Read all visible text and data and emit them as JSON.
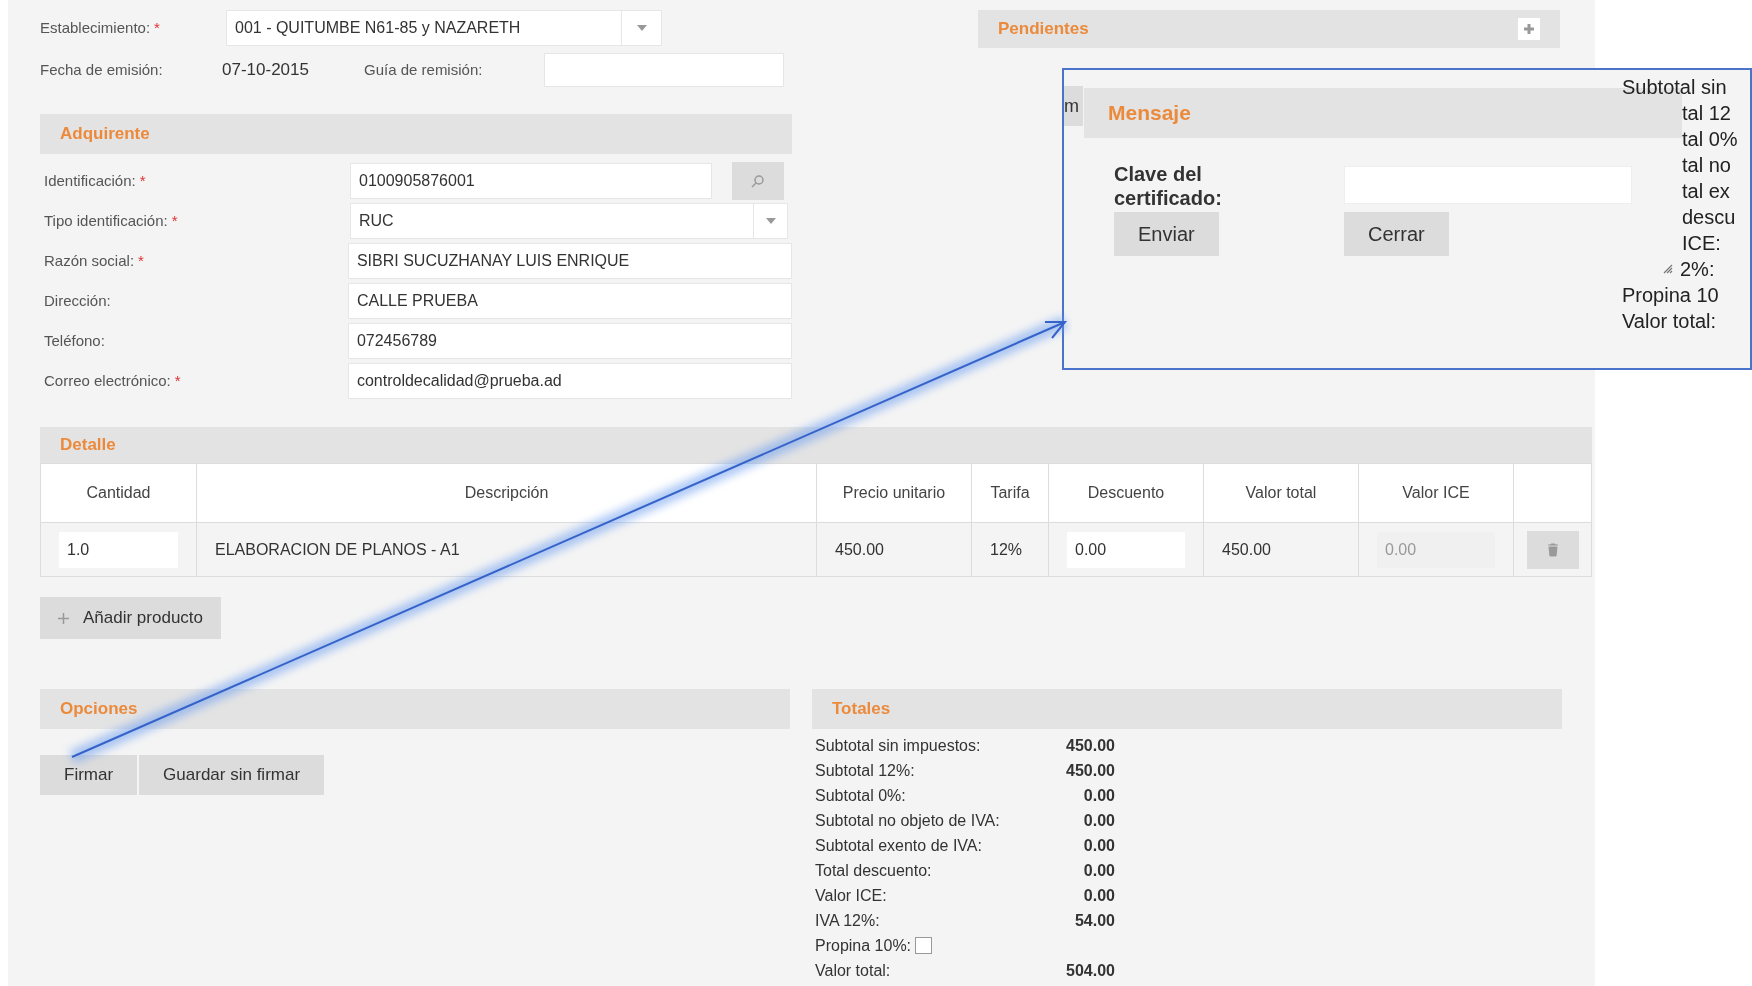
{
  "establishment": {
    "label": "Establecimiento:",
    "required_mark": "*",
    "value": "001 - QUITUMBE N61-85 y NAZARETH"
  },
  "issue_date": {
    "label": "Fecha de emisión:",
    "value": "07-10-2015"
  },
  "remission_guide": {
    "label": "Guía de remisión:"
  },
  "pending": {
    "title": "Pendientes"
  },
  "buyer": {
    "title": "Adquirente",
    "fields": [
      {
        "kind": "search",
        "label": "Identificación:",
        "required_mark": "*",
        "value": "0100905876001"
      },
      {
        "kind": "select",
        "label": "Tipo identificación:",
        "required_mark": "*",
        "value": "RUC"
      },
      {
        "kind": "text",
        "label": "Razón social:",
        "required_mark": "*",
        "value": "SIBRI SUCUZHANAY LUIS ENRIQUE"
      },
      {
        "kind": "text",
        "label": "Dirección:",
        "value": "CALLE PRUEBA"
      },
      {
        "kind": "text",
        "label": "Teléfono:",
        "value": "072456789"
      },
      {
        "kind": "text",
        "label": "Correo electrónico:",
        "required_mark": "*",
        "value": "controldecalidad@prueba.ad"
      }
    ]
  },
  "detail": {
    "title": "Detalle",
    "columns": [
      "Cantidad",
      "Descripción",
      "Precio unitario",
      "Tarifa",
      "Descuento",
      "Valor total",
      "Valor ICE"
    ],
    "rows": [
      {
        "cells": [
          {
            "kind": "input",
            "value": "1.0",
            "disabled": false
          },
          {
            "kind": "text",
            "value": "ELABORACION DE PLANOS - A1"
          },
          {
            "kind": "text",
            "value": "450.00"
          },
          {
            "kind": "text",
            "value": "12%"
          },
          {
            "kind": "input",
            "value": "0.00",
            "disabled": false
          },
          {
            "kind": "text",
            "value": "450.00"
          },
          {
            "kind": "input",
            "value": "0.00",
            "disabled": true
          }
        ]
      }
    ],
    "add_button": "Añadir producto"
  },
  "options": {
    "title": "Opciones",
    "buttons": [
      "Firmar",
      "Guardar sin firmar"
    ]
  },
  "totals": {
    "title": "Totales",
    "rows": [
      {
        "kind": "value",
        "label": "Subtotal sin impuestos:",
        "value": "450.00"
      },
      {
        "kind": "value",
        "label": "Subtotal 12%:",
        "value": "450.00"
      },
      {
        "kind": "value",
        "label": "Subtotal 0%:",
        "value": "0.00"
      },
      {
        "kind": "value",
        "label": "Subtotal no objeto de IVA:",
        "value": "0.00"
      },
      {
        "kind": "value",
        "label": "Subtotal exento de IVA:",
        "value": "0.00"
      },
      {
        "kind": "value",
        "label": "Total descuento:",
        "value": "0.00"
      },
      {
        "kind": "value",
        "label": "Valor ICE:",
        "value": "0.00"
      },
      {
        "kind": "value",
        "label": "IVA 12%:",
        "value": "54.00"
      },
      {
        "kind": "checkbox",
        "label": "Propina 10%:",
        "checked": false
      },
      {
        "kind": "value",
        "label": "Valor total:",
        "value": "504.00"
      }
    ]
  },
  "callout": {
    "fragment": "m",
    "dialog": {
      "title": "Mensaje",
      "field_label": "Clave del certificado:",
      "buttons": [
        "Enviar",
        "Cerrar"
      ]
    },
    "totals_fragments": [
      {
        "text": "Subtotal sin",
        "partial": false
      },
      {
        "text": "tal 12",
        "partial": true
      },
      {
        "text": "tal 0%",
        "partial": true
      },
      {
        "text": "tal no",
        "partial": true
      },
      {
        "text": "tal ex",
        "partial": true
      },
      {
        "text": "descu",
        "partial": true
      },
      {
        "text": "ICE:",
        "partial": true
      },
      {
        "text": "2%:",
        "partial": true
      },
      {
        "text": "Propina 10",
        "partial": false
      },
      {
        "text": "Valor total:",
        "partial": false
      }
    ]
  }
}
